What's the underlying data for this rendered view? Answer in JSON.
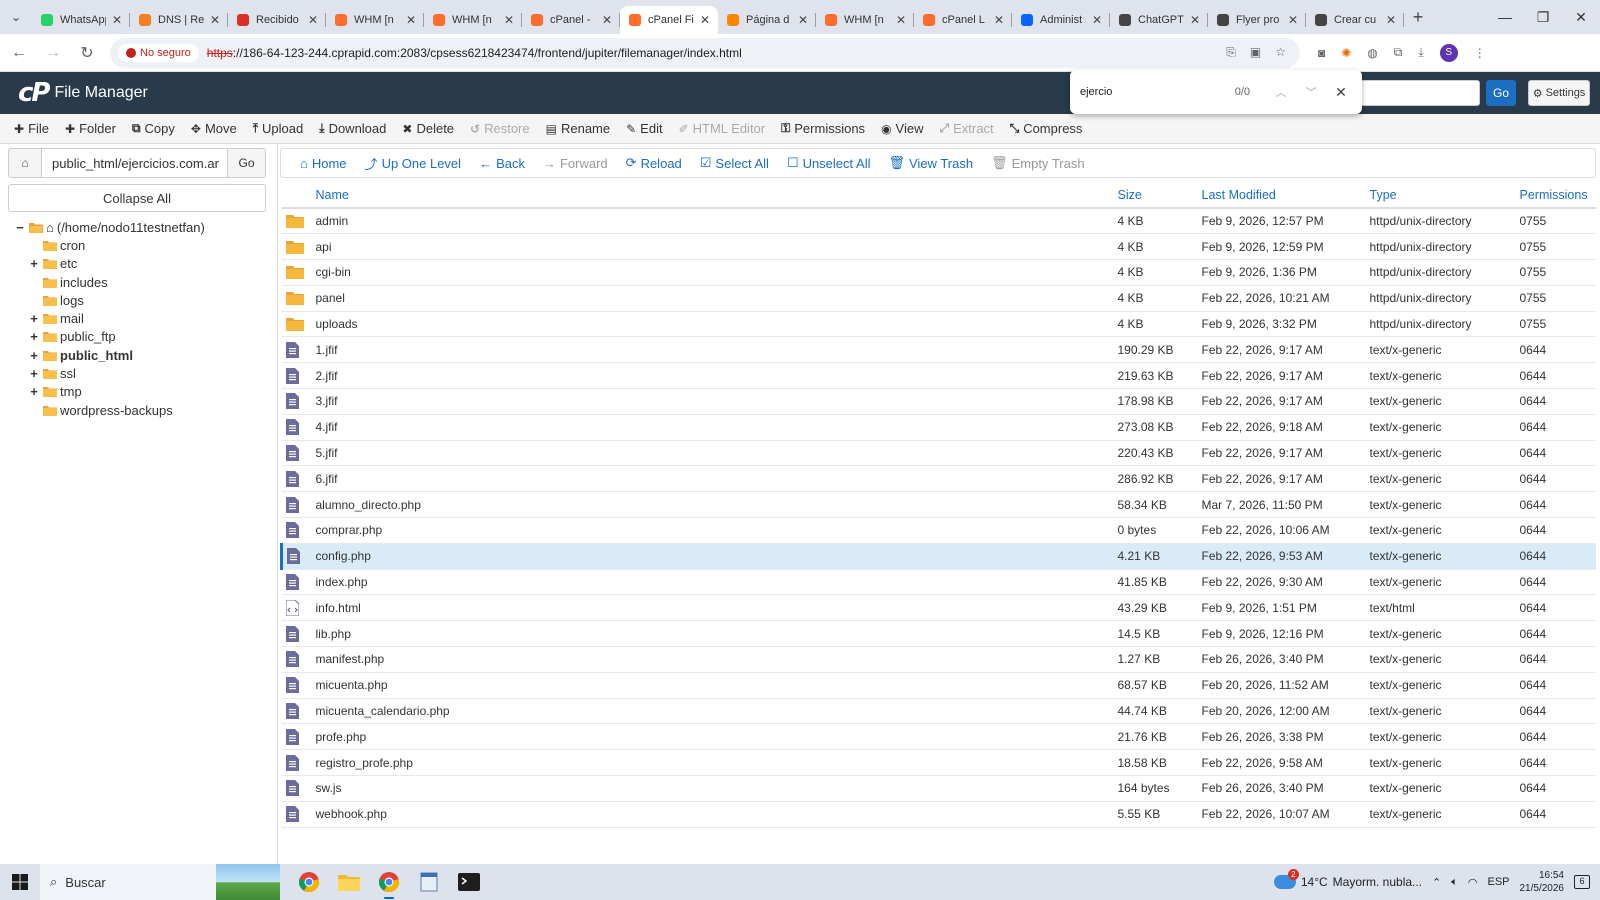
{
  "browser": {
    "tabs": [
      {
        "title": "WhatsApp",
        "icon": "whatsapp-icon",
        "color": "#25d366"
      },
      {
        "title": "DNS | Re",
        "icon": "cloudflare-icon",
        "color": "#f38020"
      },
      {
        "title": "Recibido",
        "icon": "gmail-icon",
        "color": "#d93025"
      },
      {
        "title": "WHM [n",
        "icon": "cpanel-icon",
        "color": "#ff6c2c"
      },
      {
        "title": "WHM [n",
        "icon": "cpanel-icon",
        "color": "#ff6c2c"
      },
      {
        "title": "cPanel -",
        "icon": "cpanel-icon",
        "color": "#ff6c2c"
      },
      {
        "title": "cPanel Fi",
        "icon": "cpanel-icon",
        "color": "#ff6c2c",
        "active": true
      },
      {
        "title": "Página d",
        "icon": "blogger-icon",
        "color": "#ff8400"
      },
      {
        "title": "WHM [n",
        "icon": "cpanel-icon",
        "color": "#ff6c2c"
      },
      {
        "title": "cPanel L",
        "icon": "cpanel-icon",
        "color": "#ff6c2c"
      },
      {
        "title": "Administ",
        "icon": "meta-icon",
        "color": "#0866ff"
      },
      {
        "title": "ChatGPT",
        "icon": "chatgpt-icon",
        "color": "#444444"
      },
      {
        "title": "Flyer pro",
        "icon": "chatgpt-icon",
        "color": "#444444"
      },
      {
        "title": "Crear cu",
        "icon": "chatgpt-icon",
        "color": "#444444"
      }
    ],
    "security_label": "No seguro",
    "url_scheme": "https",
    "url_rest": "://186-64-123-244.cprapid.com:2083/cpsess6218423474/frontend/jupiter/filemanager/index.html",
    "find": {
      "query": "ejercio",
      "count": "0/0"
    }
  },
  "app": {
    "title": "File Manager",
    "settings_label": "Settings",
    "go_label": "Go",
    "brand_color": "#293a4a",
    "accent_color": "#1b6ec2"
  },
  "toolbar": [
    {
      "label": "File",
      "icon": "plus-icon"
    },
    {
      "label": "Folder",
      "icon": "plus-icon"
    },
    {
      "label": "Copy",
      "icon": "copy-icon"
    },
    {
      "label": "Move",
      "icon": "move-icon"
    },
    {
      "label": "Upload",
      "icon": "upload-icon"
    },
    {
      "label": "Download",
      "icon": "download-icon"
    },
    {
      "label": "Delete",
      "icon": "delete-icon"
    },
    {
      "label": "Restore",
      "icon": "restore-icon",
      "disabled": true
    },
    {
      "label": "Rename",
      "icon": "rename-icon"
    },
    {
      "label": "Edit",
      "icon": "edit-icon"
    },
    {
      "label": "HTML Editor",
      "icon": "html-editor-icon",
      "disabled": true
    },
    {
      "label": "Permissions",
      "icon": "key-icon"
    },
    {
      "label": "View",
      "icon": "eye-icon"
    },
    {
      "label": "Extract",
      "icon": "extract-icon",
      "disabled": true
    },
    {
      "label": "Compress",
      "icon": "compress-icon"
    }
  ],
  "sidebar": {
    "path_value": "public_html/ejercicios.com.ar",
    "go_label": "Go",
    "collapse_label": "Collapse All",
    "root_label": "(/home/nodo11testnetfan)",
    "items": [
      {
        "label": "cron",
        "expandable": false
      },
      {
        "label": "etc",
        "expandable": true
      },
      {
        "label": "includes",
        "expandable": false
      },
      {
        "label": "logs",
        "expandable": false
      },
      {
        "label": "mail",
        "expandable": true
      },
      {
        "label": "public_ftp",
        "expandable": true
      },
      {
        "label": "public_html",
        "expandable": true,
        "bold": true
      },
      {
        "label": "ssl",
        "expandable": true
      },
      {
        "label": "tmp",
        "expandable": true
      },
      {
        "label": "wordpress-backups",
        "expandable": false
      }
    ]
  },
  "actions": [
    {
      "label": "Home",
      "icon": "home-icon"
    },
    {
      "label": "Up One Level",
      "icon": "level-up-icon"
    },
    {
      "label": "Back",
      "icon": "arrow-left-icon"
    },
    {
      "label": "Forward",
      "icon": "arrow-right-icon",
      "disabled": true
    },
    {
      "label": "Reload",
      "icon": "reload-icon"
    },
    {
      "label": "Select All",
      "icon": "checkbox-checked-icon"
    },
    {
      "label": "Unselect All",
      "icon": "checkbox-empty-icon"
    },
    {
      "label": "View Trash",
      "icon": "trash-icon"
    },
    {
      "label": "Empty Trash",
      "icon": "trash-icon",
      "disabled": true
    }
  ],
  "table": {
    "columns": [
      "Name",
      "Size",
      "Last Modified",
      "Type",
      "Permissions"
    ],
    "rows": [
      {
        "kind": "folder",
        "name": "admin",
        "size": "4 KB",
        "modified": "Feb 9, 2026, 12:57 PM",
        "type": "httpd/unix-directory",
        "perms": "0755"
      },
      {
        "kind": "folder",
        "name": "api",
        "size": "4 KB",
        "modified": "Feb 9, 2026, 12:59 PM",
        "type": "httpd/unix-directory",
        "perms": "0755"
      },
      {
        "kind": "folder",
        "name": "cgi-bin",
        "size": "4 KB",
        "modified": "Feb 9, 2026, 1:36 PM",
        "type": "httpd/unix-directory",
        "perms": "0755"
      },
      {
        "kind": "folder",
        "name": "panel",
        "size": "4 KB",
        "modified": "Feb 22, 2026, 10:21 AM",
        "type": "httpd/unix-directory",
        "perms": "0755"
      },
      {
        "kind": "folder",
        "name": "uploads",
        "size": "4 KB",
        "modified": "Feb 9, 2026, 3:32 PM",
        "type": "httpd/unix-directory",
        "perms": "0755"
      },
      {
        "kind": "file",
        "name": "1.jfif",
        "size": "190.29 KB",
        "modified": "Feb 22, 2026, 9:17 AM",
        "type": "text/x-generic",
        "perms": "0644"
      },
      {
        "kind": "file",
        "name": "2.jfif",
        "size": "219.63 KB",
        "modified": "Feb 22, 2026, 9:17 AM",
        "type": "text/x-generic",
        "perms": "0644"
      },
      {
        "kind": "file",
        "name": "3.jfif",
        "size": "178.98 KB",
        "modified": "Feb 22, 2026, 9:17 AM",
        "type": "text/x-generic",
        "perms": "0644"
      },
      {
        "kind": "file",
        "name": "4.jfif",
        "size": "273.08 KB",
        "modified": "Feb 22, 2026, 9:18 AM",
        "type": "text/x-generic",
        "perms": "0644"
      },
      {
        "kind": "file",
        "name": "5.jfif",
        "size": "220.43 KB",
        "modified": "Feb 22, 2026, 9:17 AM",
        "type": "text/x-generic",
        "perms": "0644"
      },
      {
        "kind": "file",
        "name": "6.jfif",
        "size": "286.92 KB",
        "modified": "Feb 22, 2026, 9:17 AM",
        "type": "text/x-generic",
        "perms": "0644"
      },
      {
        "kind": "file",
        "name": "alumno_directo.php",
        "size": "58.34 KB",
        "modified": "Mar 7, 2026, 11:50 PM",
        "type": "text/x-generic",
        "perms": "0644"
      },
      {
        "kind": "file",
        "name": "comprar.php",
        "size": "0 bytes",
        "modified": "Feb 22, 2026, 10:06 AM",
        "type": "text/x-generic",
        "perms": "0644"
      },
      {
        "kind": "file",
        "name": "config.php",
        "size": "4.21 KB",
        "modified": "Feb 22, 2026, 9:53 AM",
        "type": "text/x-generic",
        "perms": "0644",
        "selected": true
      },
      {
        "kind": "file",
        "name": "index.php",
        "size": "41.85 KB",
        "modified": "Feb 22, 2026, 9:30 AM",
        "type": "text/x-generic",
        "perms": "0644"
      },
      {
        "kind": "html",
        "name": "info.html",
        "size": "43.29 KB",
        "modified": "Feb 9, 2026, 1:51 PM",
        "type": "text/html",
        "perms": "0644"
      },
      {
        "kind": "file",
        "name": "lib.php",
        "size": "14.5 KB",
        "modified": "Feb 9, 2026, 12:16 PM",
        "type": "text/x-generic",
        "perms": "0644"
      },
      {
        "kind": "file",
        "name": "manifest.php",
        "size": "1.27 KB",
        "modified": "Feb 26, 2026, 3:40 PM",
        "type": "text/x-generic",
        "perms": "0644"
      },
      {
        "kind": "file",
        "name": "micuenta.php",
        "size": "68.57 KB",
        "modified": "Feb 20, 2026, 11:52 AM",
        "type": "text/x-generic",
        "perms": "0644"
      },
      {
        "kind": "file",
        "name": "micuenta_calendario.php",
        "size": "44.74 KB",
        "modified": "Feb 20, 2026, 12:00 AM",
        "type": "text/x-generic",
        "perms": "0644"
      },
      {
        "kind": "file",
        "name": "profe.php",
        "size": "21.76 KB",
        "modified": "Feb 26, 2026, 3:38 PM",
        "type": "text/x-generic",
        "perms": "0644"
      },
      {
        "kind": "file",
        "name": "registro_profe.php",
        "size": "18.58 KB",
        "modified": "Feb 22, 2026, 9:58 AM",
        "type": "text/x-generic",
        "perms": "0644"
      },
      {
        "kind": "file",
        "name": "sw.js",
        "size": "164 bytes",
        "modified": "Feb 26, 2026, 3:40 PM",
        "type": "text/x-generic",
        "perms": "0644"
      },
      {
        "kind": "file",
        "name": "webhook.php",
        "size": "5.55 KB",
        "modified": "Feb 22, 2026, 10:07 AM",
        "type": "text/x-generic",
        "perms": "0644"
      }
    ]
  },
  "taskbar": {
    "search_label": "Buscar",
    "weather_badge": "2",
    "temperature": "14°C",
    "weather_text": "Mayorm. nubla...",
    "language": "ESP",
    "time": "16:54",
    "date": "21/5/2026",
    "notifications": "6"
  }
}
